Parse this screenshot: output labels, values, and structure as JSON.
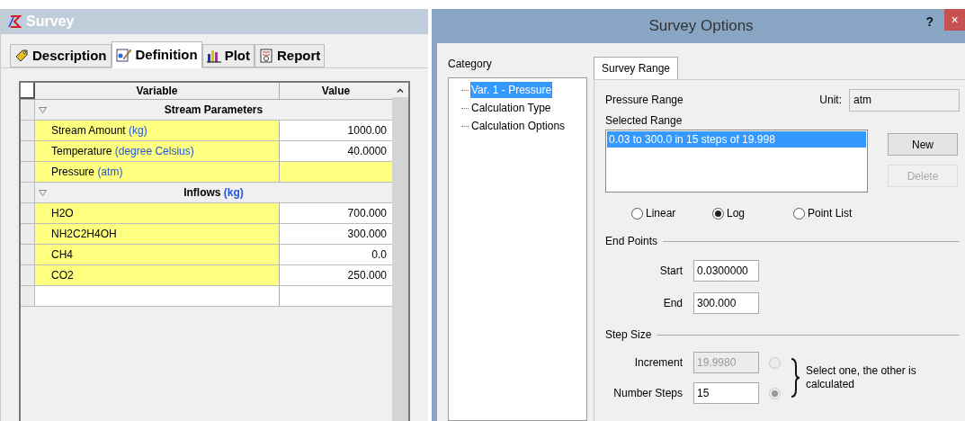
{
  "survey_window": {
    "title": "Survey",
    "tabs": [
      {
        "label": "Description",
        "selected": false
      },
      {
        "label": "Definition",
        "selected": true
      },
      {
        "label": "Plot",
        "selected": false
      },
      {
        "label": "Report",
        "selected": false
      }
    ],
    "table": {
      "columns": [
        "Variable",
        "Value"
      ],
      "rows": [
        {
          "kind": "group",
          "title": "Stream Parameters",
          "expanded": true
        },
        {
          "kind": "param",
          "label": "Stream Amount",
          "unit": "(kg)",
          "value": "1000.00",
          "value_highlighted": false
        },
        {
          "kind": "param",
          "label": "Temperature",
          "unit": "(degree Celsius)",
          "value": "40.0000",
          "value_highlighted": false
        },
        {
          "kind": "param",
          "label": "Pressure",
          "unit": "(atm)",
          "value_highlighted": true
        },
        {
          "kind": "group",
          "title": "Inflows",
          "title_unit": "(kg)",
          "expanded": true
        },
        {
          "kind": "param",
          "label": "H2O",
          "value": "700.000",
          "value_highlighted": false
        },
        {
          "kind": "param",
          "label": "NH2C2H4OH",
          "value": "300.000",
          "value_highlighted": false
        },
        {
          "kind": "param",
          "label": "CH4",
          "value": "0.0",
          "value_highlighted": false
        },
        {
          "kind": "param",
          "label": "CO2",
          "value": "250.000",
          "value_highlighted": false
        },
        {
          "kind": "empty"
        }
      ]
    }
  },
  "dialog": {
    "title": "Survey Options",
    "help": "?",
    "close": "×",
    "category": {
      "label": "Category",
      "items": [
        {
          "label": "Var. 1 - Pressure",
          "selected": true
        },
        {
          "label": "Calculation Type",
          "selected": false
        },
        {
          "label": "Calculation Options",
          "selected": false
        }
      ]
    },
    "tabs": [
      {
        "label": "Survey Range",
        "selected": true
      }
    ],
    "range_label": "Pressure Range",
    "unit_label": "Unit:",
    "unit_value": "atm",
    "selected_range_label": "Selected Range",
    "ranges": [
      {
        "label": "0.03 to 300.0 in 15 steps of 19.998",
        "selected": true
      }
    ],
    "buttons": [
      {
        "label": "New",
        "disabled": false
      },
      {
        "label": "Delete",
        "disabled": true
      }
    ],
    "scale_options": [
      {
        "label": "Linear",
        "selected": false
      },
      {
        "label": "Log",
        "selected": true
      },
      {
        "label": "Point List",
        "selected": false
      }
    ],
    "end_points": {
      "title": "End Points",
      "fields": [
        {
          "label": "Start",
          "value": "0.0300000",
          "disabled": false
        },
        {
          "label": "End",
          "value": "300.000",
          "disabled": false
        }
      ]
    },
    "step_size": {
      "title": "Step Size",
      "fields": [
        {
          "label": "Increment",
          "value": "19.9980",
          "disabled": true,
          "selected": false
        },
        {
          "label": "Number Steps",
          "value": "15",
          "disabled": false,
          "selected": true
        }
      ],
      "note": "Select one, the other is calculated"
    }
  }
}
